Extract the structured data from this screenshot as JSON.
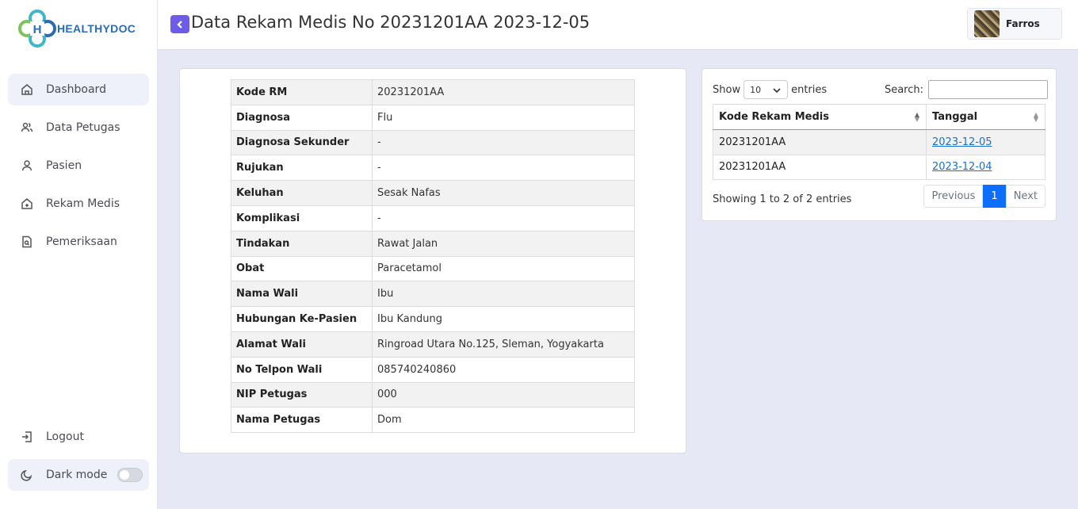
{
  "brand": {
    "name": "HEALTHYDOC"
  },
  "sidebar": {
    "items": [
      {
        "label": "Dashboard",
        "icon": "home-icon"
      },
      {
        "label": "Data Petugas",
        "icon": "users-icon"
      },
      {
        "label": "Pasien",
        "icon": "user-icon"
      },
      {
        "label": "Rekam Medis",
        "icon": "house-plus-icon"
      },
      {
        "label": "Pemeriksaan",
        "icon": "file-search-icon"
      }
    ],
    "logout_label": "Logout",
    "darkmode_label": "Dark mode",
    "darkmode_on": false
  },
  "header": {
    "title": "Data Rekam Medis No 20231201AA 2023-12-05",
    "user_name": "Farros"
  },
  "detail": {
    "rows": [
      {
        "key": "Kode RM",
        "value": "20231201AA"
      },
      {
        "key": "Diagnosa",
        "value": "Flu"
      },
      {
        "key": "Diagnosa Sekunder",
        "value": "-"
      },
      {
        "key": "Rujukan",
        "value": "-"
      },
      {
        "key": "Keluhan",
        "value": "Sesak Nafas"
      },
      {
        "key": "Komplikasi",
        "value": "-"
      },
      {
        "key": "Tindakan",
        "value": "Rawat Jalan"
      },
      {
        "key": "Obat",
        "value": "Paracetamol"
      },
      {
        "key": "Nama Wali",
        "value": "Ibu"
      },
      {
        "key": "Hubungan Ke-Pasien",
        "value": "Ibu Kandung"
      },
      {
        "key": "Alamat Wali",
        "value": "Ringroad Utara No.125, Sleman, Yogyakarta"
      },
      {
        "key": "No Telpon Wali",
        "value": "085740240860"
      },
      {
        "key": "NIP Petugas",
        "value": "000"
      },
      {
        "key": "Nama Petugas",
        "value": "Dom"
      }
    ]
  },
  "history": {
    "show_label": "Show",
    "entries_label": "entries",
    "page_length": "10",
    "search_label": "Search:",
    "search_value": "",
    "columns": [
      "Kode Rekam Medis",
      "Tanggal"
    ],
    "rows": [
      {
        "kode": "20231201AA",
        "tanggal": "2023-12-05"
      },
      {
        "kode": "20231201AA",
        "tanggal": "2023-12-04"
      }
    ],
    "info": "Showing 1 to 2 of 2 entries",
    "pager": {
      "prev": "Previous",
      "current": "1",
      "next": "Next"
    }
  }
}
